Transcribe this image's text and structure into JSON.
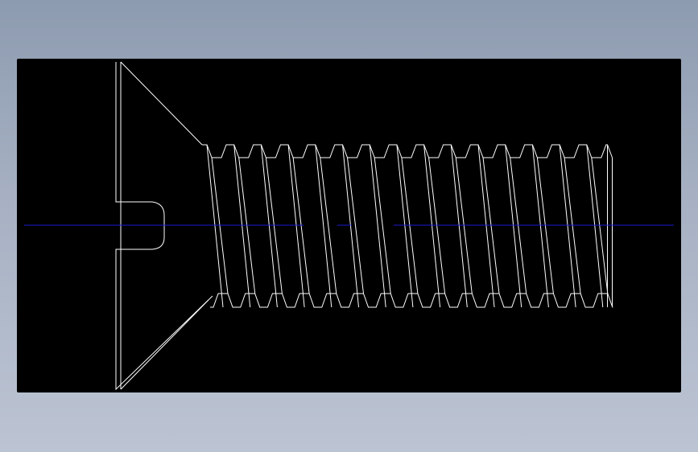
{
  "drawing": {
    "subject": "countersunk-slotted-screw",
    "background_color": "#000000",
    "outline_color": "#ffffff",
    "centerline_color": "#1c1cd0",
    "page_background_top": "#8d9bb0",
    "page_background_bottom": "#bcc4d3",
    "thread_crest_count": 15
  }
}
